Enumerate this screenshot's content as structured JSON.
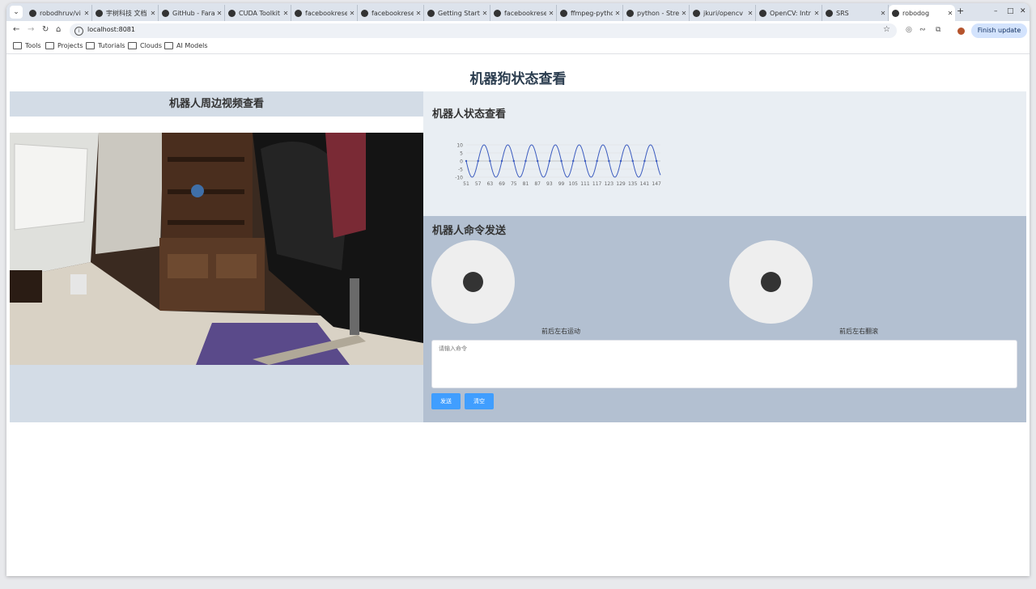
{
  "browser": {
    "tabs": [
      {
        "label": "robodhruv/vi"
      },
      {
        "label": "宇树科技 文档"
      },
      {
        "label": "GitHub - Fara"
      },
      {
        "label": "CUDA Toolkit"
      },
      {
        "label": "facebookrese"
      },
      {
        "label": "facebookrese"
      },
      {
        "label": "Getting Start"
      },
      {
        "label": "facebookrese"
      },
      {
        "label": "ffmpeg-pytho"
      },
      {
        "label": "python - Strea"
      },
      {
        "label": "jkuri/opencv"
      },
      {
        "label": "OpenCV: Intr"
      },
      {
        "label": "SRS"
      },
      {
        "label": "robodog"
      }
    ],
    "url": "localhost:8081",
    "finish_update": "Finish update",
    "bookmarks": [
      "Tools",
      "Projects",
      "Tutorials",
      "Clouds",
      "AI Models"
    ]
  },
  "page": {
    "title": "机器狗状态查看",
    "video_title": "机器人周边视频查看",
    "status_title": "机器人状态查看",
    "command_title": "机器人命令发送",
    "joystick_left_label": "前后左右运动",
    "joystick_right_label": "前后左右翻滚",
    "command_placeholder": "请输入命令",
    "send_button": "发送",
    "clear_button": "清空"
  },
  "chart_data": {
    "type": "line",
    "x_ticks": [
      51,
      57,
      63,
      69,
      75,
      81,
      87,
      93,
      99,
      105,
      111,
      117,
      123,
      129,
      135,
      141,
      147
    ],
    "y_ticks": [
      10,
      5,
      0,
      -5,
      -10
    ],
    "ylim": [
      -10,
      10
    ],
    "xlim": [
      51,
      149
    ],
    "series": [
      {
        "period": 12,
        "amplitude": 10,
        "phase_x": 57
      }
    ],
    "line_color": "#3b5bbf"
  }
}
